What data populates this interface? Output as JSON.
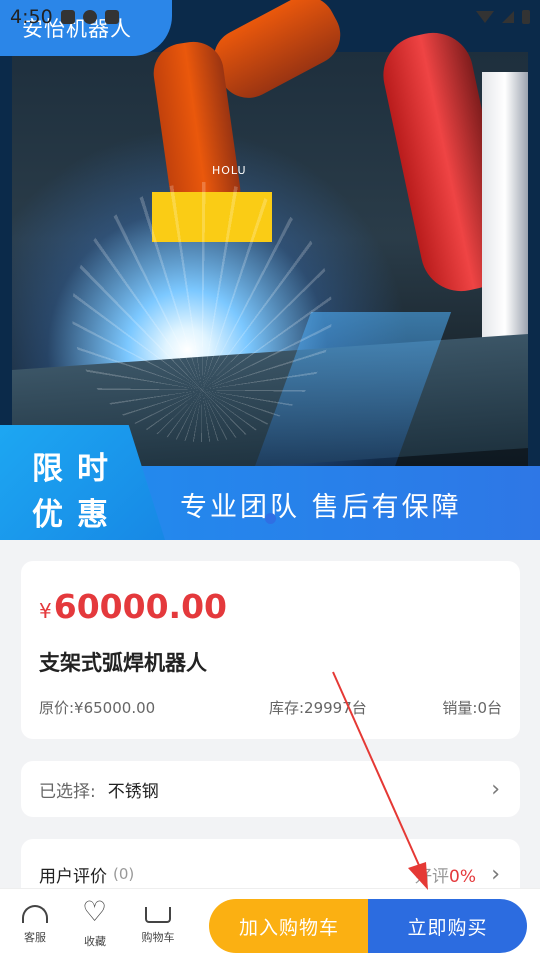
{
  "status_bar": {
    "time": "4:50"
  },
  "banner": {
    "app_title": "安怡机器人",
    "promo_line1": "限时",
    "promo_line2": "优惠",
    "slogan": "专业团队  售后有保障",
    "scene_label": "HOLU"
  },
  "product": {
    "currency_symbol": "¥",
    "price": "60000.00",
    "name": "支架式弧焊机器人",
    "original_price": "原价:¥65000.00",
    "stock": "库存:29997台",
    "sales": "销量:0台"
  },
  "selection": {
    "label": "已选择:",
    "value": "不锈钢",
    "chevron": "›"
  },
  "reviews": {
    "title": "用户评价",
    "count": "(0)",
    "good_label": "好评",
    "good_rate": "0%",
    "chevron": "›"
  },
  "bottom_bar": {
    "service_label": "客服",
    "favorite_label": "收藏",
    "cart_label": "购物车",
    "add_to_cart_label": "加入购物车",
    "buy_now_label": "立即购买"
  },
  "colors": {
    "price_red": "#e4393c",
    "cart_button": "#fbb012",
    "buy_button": "#2c6ce0",
    "banner_blue": "#1f8ff0",
    "annotation_arrow": "#e53935"
  }
}
